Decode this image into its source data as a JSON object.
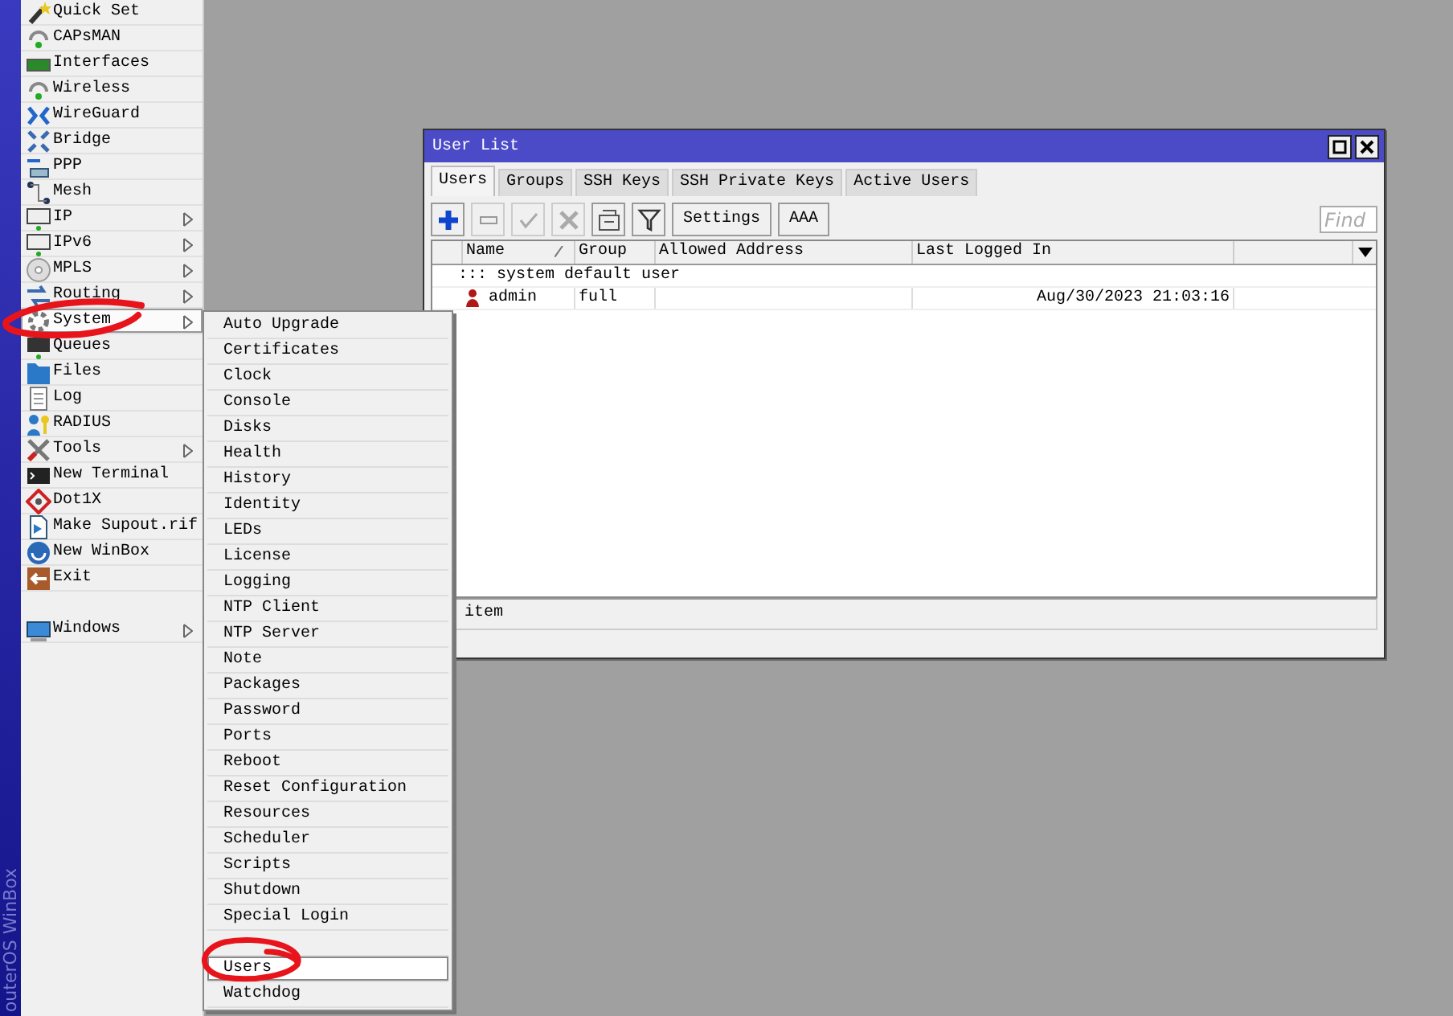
{
  "sidebar": {
    "brand": "outerOS WinBox",
    "items": [
      {
        "label": "Quick Set",
        "submenu": false,
        "selected": false
      },
      {
        "label": "CAPsMAN",
        "submenu": false,
        "selected": false
      },
      {
        "label": "Interfaces",
        "submenu": false,
        "selected": false
      },
      {
        "label": "Wireless",
        "submenu": false,
        "selected": false
      },
      {
        "label": "WireGuard",
        "submenu": false,
        "selected": false
      },
      {
        "label": "Bridge",
        "submenu": false,
        "selected": false
      },
      {
        "label": "PPP",
        "submenu": false,
        "selected": false
      },
      {
        "label": "Mesh",
        "submenu": false,
        "selected": false
      },
      {
        "label": "IP",
        "submenu": true,
        "selected": false
      },
      {
        "label": "IPv6",
        "submenu": true,
        "selected": false
      },
      {
        "label": "MPLS",
        "submenu": true,
        "selected": false
      },
      {
        "label": "Routing",
        "submenu": true,
        "selected": false
      },
      {
        "label": "System",
        "submenu": true,
        "selected": true
      },
      {
        "label": "Queues",
        "submenu": false,
        "selected": false
      },
      {
        "label": "Files",
        "submenu": false,
        "selected": false
      },
      {
        "label": "Log",
        "submenu": false,
        "selected": false
      },
      {
        "label": "RADIUS",
        "submenu": false,
        "selected": false
      },
      {
        "label": "Tools",
        "submenu": true,
        "selected": false
      },
      {
        "label": "New Terminal",
        "submenu": false,
        "selected": false
      },
      {
        "label": "Dot1X",
        "submenu": false,
        "selected": false
      },
      {
        "label": "Make Supout.rif",
        "submenu": false,
        "selected": false
      },
      {
        "label": "New WinBox",
        "submenu": false,
        "selected": false
      },
      {
        "label": "Exit",
        "submenu": false,
        "selected": false
      }
    ],
    "bottom_items": [
      {
        "label": "Windows",
        "submenu": true,
        "selected": false
      }
    ]
  },
  "system_menu": {
    "items": [
      {
        "kind": "entry",
        "label": "Auto Upgrade",
        "selected": false
      },
      {
        "kind": "entry",
        "label": "Certificates",
        "selected": false
      },
      {
        "kind": "entry",
        "label": "Clock",
        "selected": false
      },
      {
        "kind": "entry",
        "label": "Console",
        "selected": false
      },
      {
        "kind": "entry",
        "label": "Disks",
        "selected": false
      },
      {
        "kind": "entry",
        "label": "Health",
        "selected": false
      },
      {
        "kind": "entry",
        "label": "History",
        "selected": false
      },
      {
        "kind": "entry",
        "label": "Identity",
        "selected": false
      },
      {
        "kind": "entry",
        "label": "LEDs",
        "selected": false
      },
      {
        "kind": "entry",
        "label": "License",
        "selected": false
      },
      {
        "kind": "entry",
        "label": "Logging",
        "selected": false
      },
      {
        "kind": "entry",
        "label": "NTP Client",
        "selected": false
      },
      {
        "kind": "entry",
        "label": "NTP Server",
        "selected": false
      },
      {
        "kind": "entry",
        "label": "Note",
        "selected": false
      },
      {
        "kind": "entry",
        "label": "Packages",
        "selected": false
      },
      {
        "kind": "entry",
        "label": "Password",
        "selected": false
      },
      {
        "kind": "entry",
        "label": "Ports",
        "selected": false
      },
      {
        "kind": "entry",
        "label": "Reboot",
        "selected": false
      },
      {
        "kind": "entry",
        "label": "Reset Configuration",
        "selected": false
      },
      {
        "kind": "entry",
        "label": "Resources",
        "selected": false
      },
      {
        "kind": "entry",
        "label": "Scheduler",
        "selected": false
      },
      {
        "kind": "entry",
        "label": "Scripts",
        "selected": false
      },
      {
        "kind": "entry",
        "label": "Shutdown",
        "selected": false
      },
      {
        "kind": "entry",
        "label": "Special Login",
        "selected": false
      },
      {
        "kind": "obscured"
      },
      {
        "kind": "entry",
        "label": "Users",
        "selected": true
      },
      {
        "kind": "entry",
        "label": "Watchdog",
        "selected": false
      }
    ]
  },
  "window": {
    "title": "User List",
    "tabs": [
      {
        "label": "Users",
        "selected": true
      },
      {
        "label": "Groups",
        "selected": false
      },
      {
        "label": "SSH Keys",
        "selected": false
      },
      {
        "label": "SSH Private Keys",
        "selected": false
      },
      {
        "label": "Active Users",
        "selected": false
      }
    ],
    "toolbar": [
      {
        "kind": "add",
        "disabled": false
      },
      {
        "kind": "remove",
        "disabled": true
      },
      {
        "kind": "enable",
        "disabled": true
      },
      {
        "kind": "disable",
        "disabled": true
      },
      {
        "kind": "comment",
        "disabled": false
      },
      {
        "kind": "filter",
        "disabled": false
      },
      {
        "kind": "text",
        "label": "Settings",
        "disabled": false
      },
      {
        "kind": "text",
        "label": "AAA",
        "disabled": false
      }
    ],
    "find": {
      "placeholder": "Find"
    },
    "table": {
      "columns": [
        {
          "label": "Name",
          "sorted": true
        },
        {
          "label": "Group",
          "sorted": false
        },
        {
          "label": "Allowed Address",
          "sorted": false
        },
        {
          "label": "Last Logged In",
          "sorted": false
        }
      ],
      "rows": [
        {
          "kind": "group",
          "label": "::: system default user"
        },
        {
          "kind": "user",
          "cells": [
            "admin",
            "full",
            "",
            "Aug/30/2023 21:03:16"
          ]
        }
      ]
    },
    "status_bar": "item"
  }
}
